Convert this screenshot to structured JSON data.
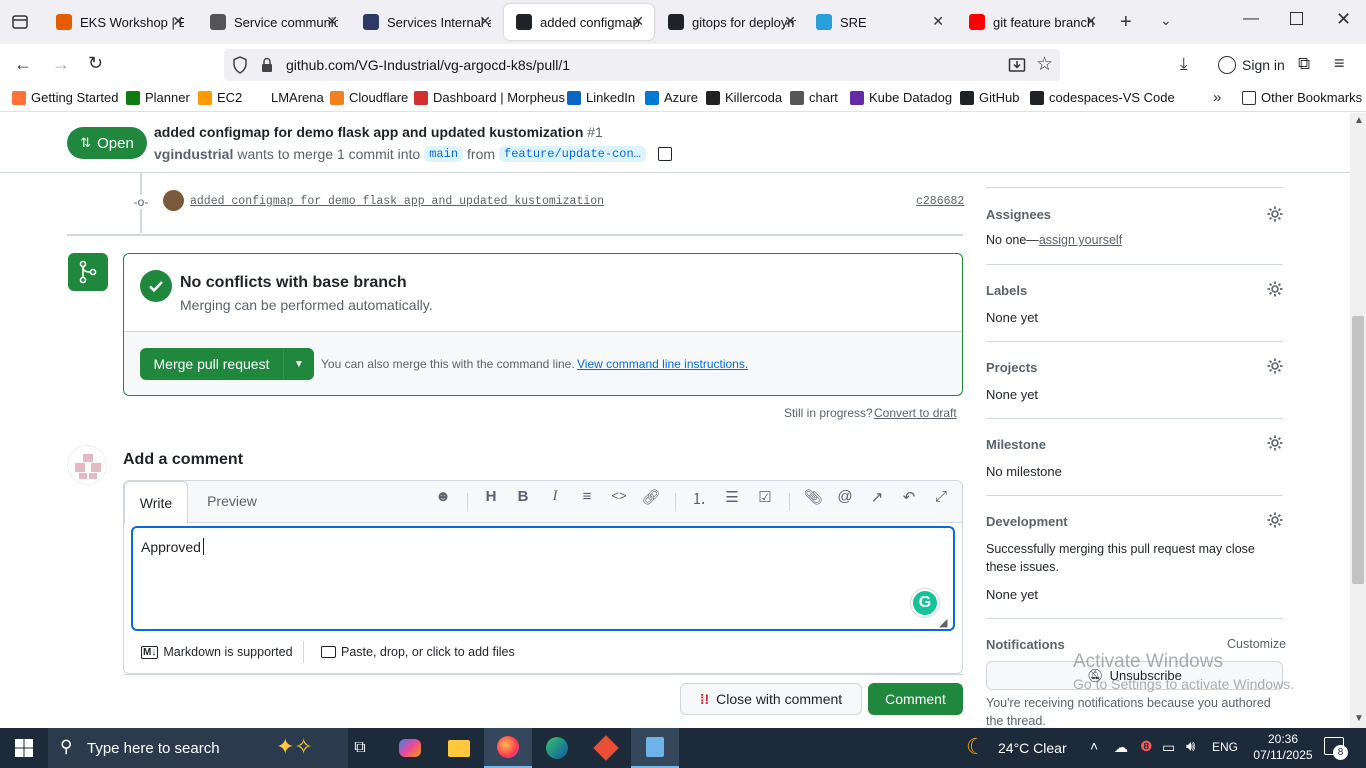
{
  "browser": {
    "tabs": [
      {
        "title": "EKS Workshop | EKS",
        "color": "#e65c00",
        "icon": "eks-icon"
      },
      {
        "title": "Service communication",
        "color": "#555555",
        "icon": "service-icon"
      },
      {
        "title": "Services Internal and",
        "color": "#2b3a67",
        "icon": "l-icon"
      },
      {
        "title": "added configmap",
        "color": "#1f2328",
        "icon": "github-icon",
        "active": true
      },
      {
        "title": "gitops for deployment",
        "color": "#1f2328",
        "icon": "github-icon"
      },
      {
        "title": "SRE",
        "color": "#2aa1da",
        "icon": "telegram-icon"
      },
      {
        "title": "git feature branch",
        "color": "#ff0000",
        "icon": "youtube-icon"
      }
    ],
    "url": "github.com/VG-Industrial/vg-argocd-k8s/pull/1",
    "sign_in": "Sign in",
    "bookmarks": [
      {
        "label": "Getting Started",
        "color": "#ff7139"
      },
      {
        "label": "Planner",
        "color": "#107c10"
      },
      {
        "label": "EC2",
        "color": "#ff9900"
      },
      {
        "label": "LMArena",
        "color": "#ffffff"
      },
      {
        "label": "Cloudflare",
        "color": "#f38020"
      },
      {
        "label": "Dashboard | Morpheus",
        "color": "#d32f2f"
      },
      {
        "label": "LinkedIn",
        "color": "#0a66c2"
      },
      {
        "label": "Azure",
        "color": "#0078d4"
      },
      {
        "label": "Killercoda",
        "color": "#222222"
      },
      {
        "label": "chart",
        "color": "#555555"
      },
      {
        "label": "Kube Datadog",
        "color": "#632ca6"
      },
      {
        "label": "GitHub",
        "color": "#1f2328"
      },
      {
        "label": "codespaces-VS Code",
        "color": "#1f2328"
      }
    ],
    "other_bookmarks": "Other Bookmarks"
  },
  "pr": {
    "state": "Open",
    "title": "added configmap for demo flask app and updated kustomization",
    "number": "#1",
    "author": "vgindustrial",
    "merge_text": "wants to merge 1 commit into",
    "base": "main",
    "from": "from",
    "head": "feature/update-con…"
  },
  "commit": {
    "message": "added configmap for demo flask app and updated kustomization",
    "sha": "c286682"
  },
  "merge": {
    "title": "No conflicts with base branch",
    "subtitle": "Merging can be performed automatically.",
    "button": "Merge pull request",
    "hint": "You can also merge this with the command line.",
    "hint_link": "View command line instructions.",
    "draft_text": "Still in progress?",
    "draft_link": "Convert to draft"
  },
  "comment": {
    "heading": "Add a comment",
    "tab_write": "Write",
    "tab_preview": "Preview",
    "text": "Approved",
    "markdown": "Markdown is supported",
    "attach": "Paste, drop, or click to add files",
    "close_button": "Close with comment",
    "submit_button": "Comment"
  },
  "sidebar": {
    "assignees_title": "Assignees",
    "assignees_value": "No one—",
    "assign_link": "assign yourself",
    "labels_title": "Labels",
    "labels_value": "None yet",
    "projects_title": "Projects",
    "projects_value": "None yet",
    "milestone_title": "Milestone",
    "milestone_value": "No milestone",
    "development_title": "Development",
    "development_text": "Successfully merging this pull request may close these issues.",
    "development_value": "None yet",
    "notifications_title": "Notifications",
    "customize": "Customize",
    "unsubscribe": "Unsubscribe",
    "notif_text": "You're receiving notifications because you authored the thread."
  },
  "watermark": {
    "line1": "Activate Windows",
    "line2": "Go to Settings to activate Windows."
  },
  "taskbar": {
    "search": "Type here to search",
    "weather": "24°C  Clear",
    "lang": "ENG",
    "time": "20:36",
    "date": "07/11/2025",
    "notif_count": "8"
  }
}
